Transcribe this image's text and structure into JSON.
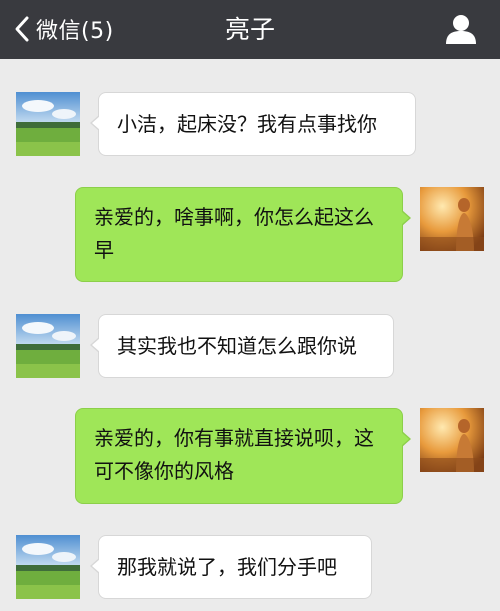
{
  "header": {
    "back_label": "微信(5)",
    "title": "亮子",
    "back_icon": "chevron-left-icon",
    "profile_icon": "person-icon"
  },
  "colors": {
    "header_bg": "#393a3f",
    "chat_bg": "#ebebeb",
    "sent_bubble": "#9fe658",
    "received_bubble": "#ffffff"
  },
  "messages": [
    {
      "side": "left",
      "text": "小洁，起床没？我有点事找你"
    },
    {
      "side": "right",
      "text": "亲爱的，啥事啊，你怎么起这么早"
    },
    {
      "side": "left",
      "text": "其实我也不知道怎么跟你说"
    },
    {
      "side": "right",
      "text": "亲爱的，你有事就直接说呗，这可不像你的风格"
    },
    {
      "side": "left",
      "text": "那我就说了，我们分手吧"
    }
  ]
}
